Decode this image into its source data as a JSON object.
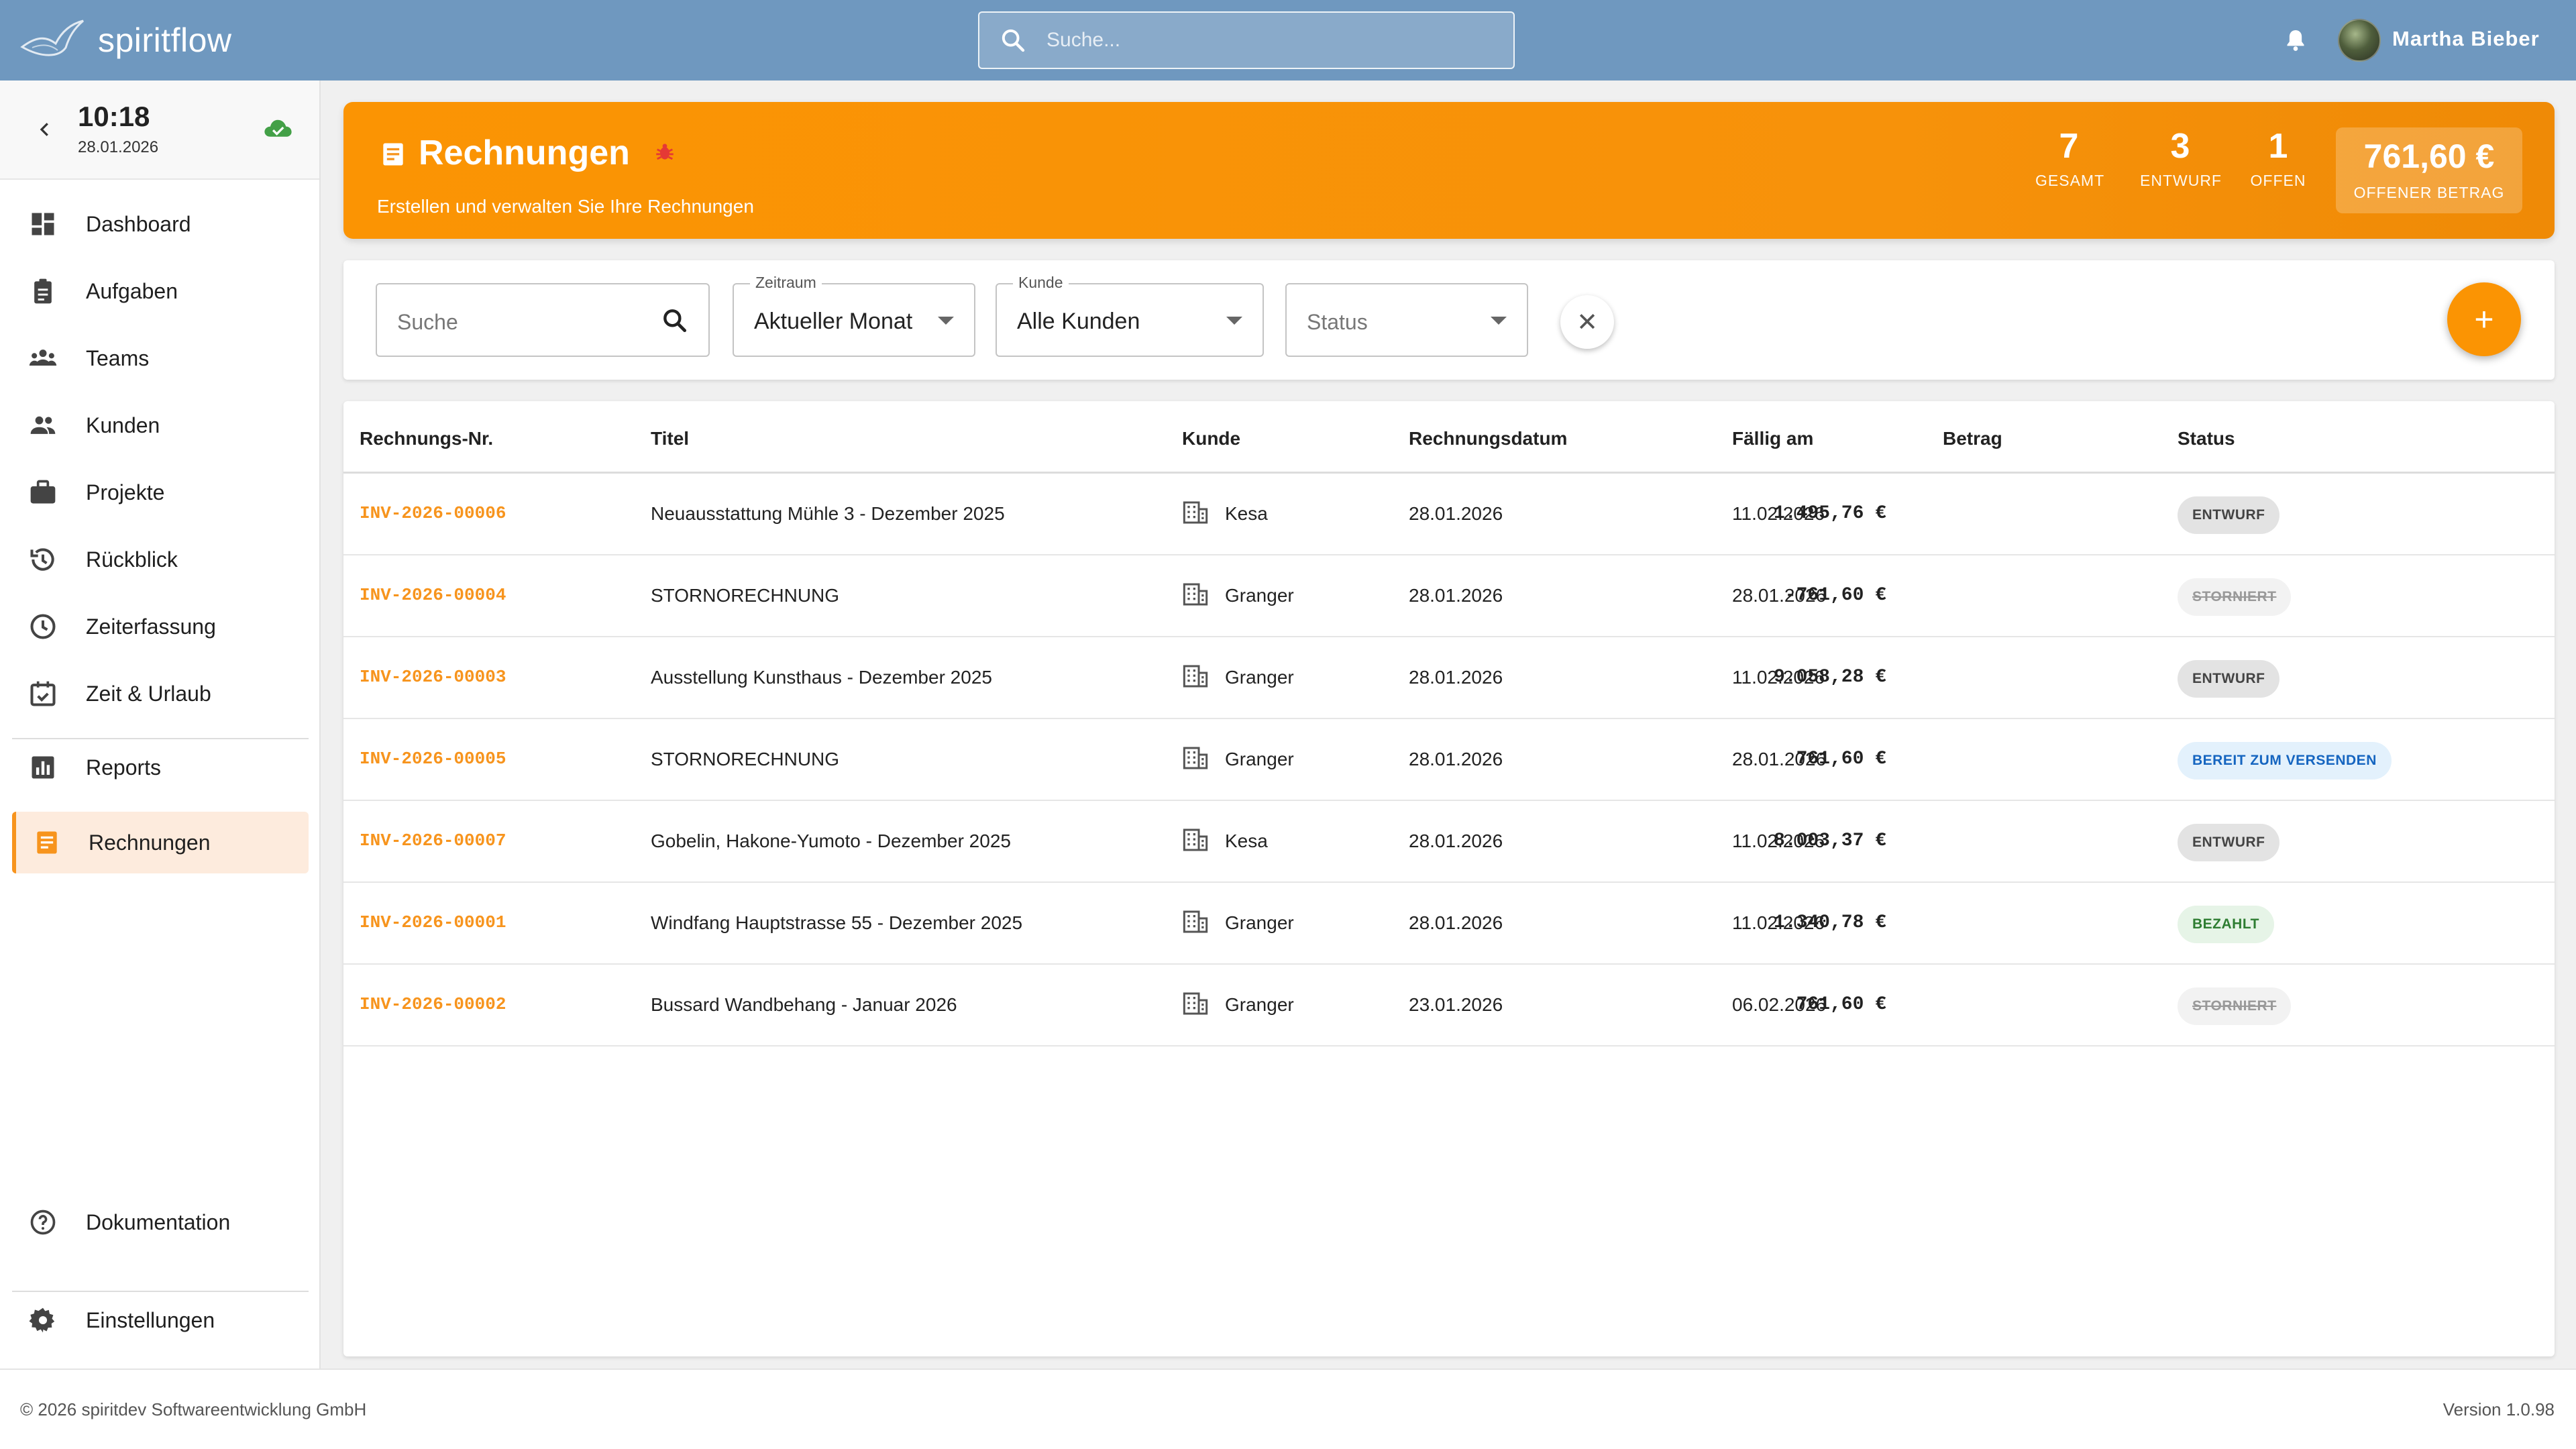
{
  "app": {
    "brand": "spiritflow",
    "search_placeholder": "Suche...",
    "user_name": "Martha Bieber"
  },
  "sidebar": {
    "time": "10:18",
    "date": "28.01.2026",
    "items": [
      {
        "label": "Dashboard",
        "icon": "dashboard-icon"
      },
      {
        "label": "Aufgaben",
        "icon": "clipboard-icon"
      },
      {
        "label": "Teams",
        "icon": "groups-icon"
      },
      {
        "label": "Kunden",
        "icon": "people-icon"
      },
      {
        "label": "Projekte",
        "icon": "briefcase-icon"
      },
      {
        "label": "Rückblick",
        "icon": "history-icon"
      },
      {
        "label": "Zeiterfassung",
        "icon": "clock-icon"
      },
      {
        "label": "Zeit & Urlaub",
        "icon": "calendar-check-icon"
      },
      {
        "label": "Reports",
        "icon": "bar-chart-icon"
      },
      {
        "label": "Rechnungen",
        "icon": "receipt-icon",
        "active": true
      },
      {
        "label": "Dokumentation",
        "icon": "help-circle-icon"
      },
      {
        "label": "Einstellungen",
        "icon": "gear-icon"
      }
    ]
  },
  "header": {
    "title": "Rechnungen",
    "subtitle": "Erstellen und verwalten Sie Ihre Rechnungen",
    "stats": [
      {
        "value": "7",
        "label": "GESAMT"
      },
      {
        "value": "3",
        "label": "ENTWURF"
      },
      {
        "value": "1",
        "label": "OFFEN"
      }
    ],
    "open_amount": "761,60 €",
    "open_amount_label": "OFFENER BETRAG",
    "accent": "#fb9403"
  },
  "filters": {
    "search_placeholder": "Suche",
    "period_label": "Zeitraum",
    "period_value": "Aktueller Monat",
    "customer_label": "Kunde",
    "customer_value": "Alle Kunden",
    "status_placeholder": "Status",
    "clear_symbol": "✕",
    "add_symbol": "+"
  },
  "table": {
    "columns": [
      "Rechnungs-Nr.",
      "Titel",
      "Kunde",
      "Rechnungsdatum",
      "Fällig am",
      "Betrag",
      "Status"
    ],
    "rows": [
      {
        "nr": "INV-2026-00006",
        "title": "Neuausstattung Mühle 3 - Dezember 2025",
        "customer": "Kesa",
        "date": "28.01.2026",
        "due": "11.02.2026",
        "amount": "1.495,76 €",
        "status": "ENTWURF",
        "status_kind": "entwurf"
      },
      {
        "nr": "INV-2026-00004",
        "title": "STORNORECHNUNG",
        "customer": "Granger",
        "date": "28.01.2026",
        "due": "28.01.2026",
        "amount": "-761,60 €",
        "status": "STORNIERT",
        "status_kind": "storniert"
      },
      {
        "nr": "INV-2026-00003",
        "title": "Ausstellung Kunsthaus - Dezember 2025",
        "customer": "Granger",
        "date": "28.01.2026",
        "due": "11.02.2026",
        "amount": "9.058,28 €",
        "status": "ENTWURF",
        "status_kind": "entwurf"
      },
      {
        "nr": "INV-2026-00005",
        "title": "STORNORECHNUNG",
        "customer": "Granger",
        "date": "28.01.2026",
        "due": "28.01.2026",
        "amount": "761,60 €",
        "status": "BEREIT ZUM VERSENDEN",
        "status_kind": "bereit"
      },
      {
        "nr": "INV-2026-00007",
        "title": "Gobelin, Hakone-Yumoto - Dezember 2025",
        "customer": "Kesa",
        "date": "28.01.2026",
        "due": "11.02.2026",
        "amount": "8.003,37 €",
        "status": "ENTWURF",
        "status_kind": "entwurf"
      },
      {
        "nr": "INV-2026-00001",
        "title": "Windfang Hauptstrasse 55 - Dezember 2025",
        "customer": "Granger",
        "date": "28.01.2026",
        "due": "11.02.2026",
        "amount": "1.340,78 €",
        "status": "BEZAHLT",
        "status_kind": "bezahlt"
      },
      {
        "nr": "INV-2026-00002",
        "title": "Bussard Wandbehang - Januar 2026",
        "customer": "Granger",
        "date": "23.01.2026",
        "due": "06.02.2026",
        "amount": "761,60 €",
        "status": "STORNIERT",
        "status_kind": "storniert"
      }
    ]
  },
  "footer": {
    "copyright": "© 2026 spiritdev Softwareentwicklung GmbH",
    "version": "Version 1.0.98"
  }
}
